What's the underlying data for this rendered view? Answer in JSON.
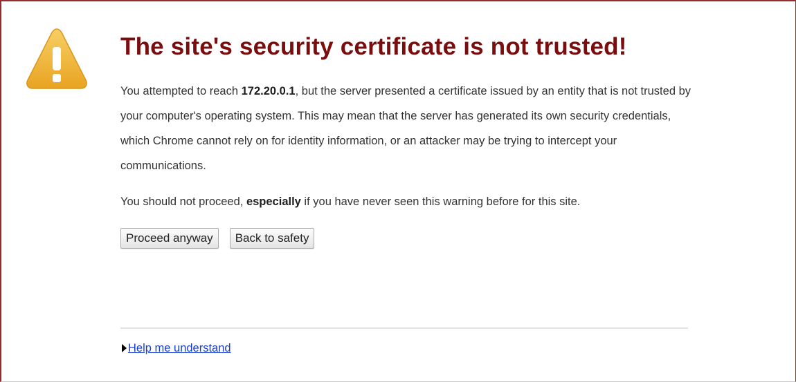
{
  "page": {
    "title": "The site's security certificate is not trusted!",
    "paragraph1": {
      "before": "You attempted to reach ",
      "host": "172.20.0.1",
      "after": ", but the server presented a certificate issued by an entity that is not trusted by your computer's operating system. This may mean that the server has generated its own security credentials, which Chrome cannot rely on for identity information, or an attacker may be trying to intercept your communications."
    },
    "paragraph2": {
      "before": "You should not proceed, ",
      "emphasis": "especially",
      "after": " if you have never seen this warning before for this site."
    },
    "buttons": {
      "proceed": "Proceed anyway",
      "back": "Back to safety"
    },
    "help_link": "Help me understand"
  },
  "icons": {
    "warning": "warning-triangle-icon",
    "expand": "triangle-right-icon"
  },
  "colors": {
    "title": "#7a0d0d",
    "frame_border": "#9b2a2a",
    "warning_fill": "#f3b73c",
    "link": "#1a3fcf"
  }
}
